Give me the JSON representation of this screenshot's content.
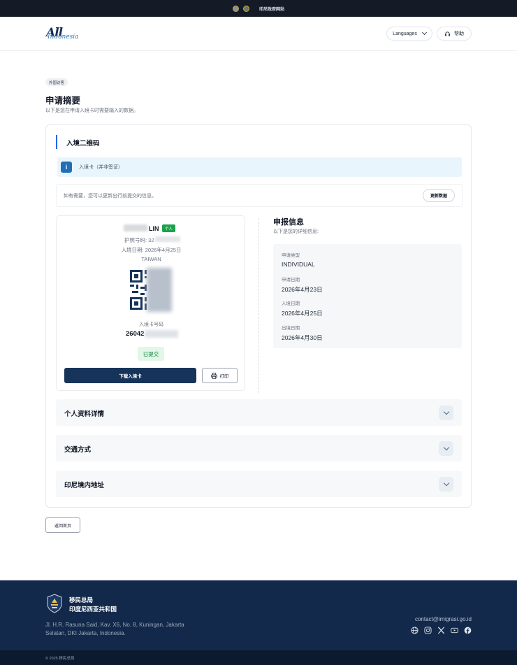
{
  "topbar": {
    "gov_label": "印尼政府网站"
  },
  "header": {
    "logo_all": "All",
    "logo_sub": "Indonesia",
    "languages_label": "Languages",
    "help_label": "帮助"
  },
  "page": {
    "badge": "外国访客",
    "title": "申请摘要",
    "subtitle": "以下是您在申请入境卡时需要输入的数据。"
  },
  "card": {
    "section_title": "入境二维码",
    "info_text": "入境卡（并非签证）",
    "update_text": "如有需要，您可以更新出行前提交的信息。",
    "update_button": "更新数据"
  },
  "qr_panel": {
    "name_suffix": "LIN",
    "type_badge": "个人",
    "passport_line": "护照号码: 32",
    "entry_date_line": "入境日期: 2026年4月25日",
    "country": "TAIWAN",
    "card_number_label": "入境卡号码",
    "card_number": "26042",
    "status": "已提交",
    "download_button": "下载入境卡",
    "print_button": "打印"
  },
  "declaration": {
    "title": "申报信息",
    "subtitle": "以下是您的详细信息:",
    "fields": [
      {
        "label": "申请类型",
        "value": "INDIVIDUAL"
      },
      {
        "label": "申请日期",
        "value": "2026年4月23日"
      },
      {
        "label": "入境日期",
        "value": "2026年4月25日"
      },
      {
        "label": "出境日期",
        "value": "2026年4月30日"
      }
    ]
  },
  "accordions": [
    {
      "title": "个人资料详情"
    },
    {
      "title": "交通方式"
    },
    {
      "title": "印尼境内地址"
    }
  ],
  "back_button": "返回首页",
  "footer": {
    "org_line1": "移民总局",
    "org_line2": "印度尼西亚共和国",
    "address": "Jl. H.R. Rasuna Said, Kav. X6, No. 8, Kuningan, Jakarta Selatan, DKI Jakarta, Indonesia.",
    "email": "contact@imigrasi.go.id",
    "social_icons": [
      "globe-icon",
      "instagram-icon",
      "x-icon",
      "youtube-icon",
      "facebook-icon"
    ],
    "copyright": "© 2025 移民总局"
  },
  "colors": {
    "navy": "#16345a",
    "topbar": "#141b26",
    "footer": "#13294b",
    "accent_blue": "#2563eb",
    "success_green": "#18a34a",
    "info_bg": "#e9f5fd"
  }
}
